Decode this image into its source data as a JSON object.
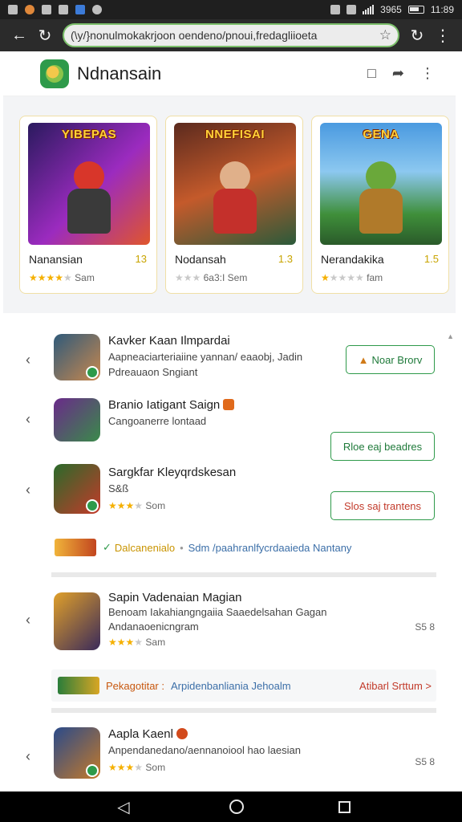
{
  "status_bar": {
    "time": "11:89",
    "network": "3965"
  },
  "browser": {
    "url": "(\\y/}nonulmokakrjoon oendeno/pnoui,fredagliioeta",
    "back_icon": "arrow-left-icon",
    "reload_icon": "reload-icon",
    "bookmark_icon": "star-icon",
    "menu_icon": "more-vert-icon"
  },
  "app": {
    "title": "Ndnansain",
    "logo_icon": "app-logo-icon",
    "actions": [
      "bookmark-icon",
      "share-icon",
      "more-vert-icon"
    ]
  },
  "featured": [
    {
      "banner": "YIBEPAS",
      "name": "Nanansian",
      "score": "13",
      "meta": "Sam",
      "stars_on": 4,
      "stars_total": 5,
      "accent": "#7b2fbf"
    },
    {
      "banner": "NNEFISAI",
      "name": "Nodansah",
      "score": "1.3",
      "meta": "6a3:I Sem",
      "stars_on": 0,
      "stars_total": 3,
      "accent": "#c43b2b"
    },
    {
      "banner": "GENA",
      "name": "Nerandakika",
      "score": "1.5",
      "meta": "fam",
      "stars_on": 1,
      "stars_total": 5,
      "accent": "#3f8f3a"
    }
  ],
  "list": [
    {
      "title": "Kavker Kaan Ilmpardai",
      "sub": "Aapneaciarteriaiine yannan/ eaaobj, Jadin",
      "meta": "Pdreauaon Sngiant",
      "button": "Noar Brorv"
    },
    {
      "title": "Branio Iatigant Saign",
      "sub": "Cangoanerre lontaad",
      "button": "Rloe eaj beadres"
    },
    {
      "title": "Sargkfar Kleyqrdskesan",
      "sub": "S&ß",
      "meta": "Som",
      "button": "Slos saj trantens"
    },
    {
      "title": "Sapin Vadenaian Magian",
      "sub": "Benoam Iakahiangngaiia Saaedelsahan Gagan",
      "sub2": "Andanaoenicngram",
      "meta": "Sam",
      "price": "S5 8"
    },
    {
      "title": "Aapla Kaenl",
      "sub": "Anpendanedano/aennanoiool  hao laesian",
      "meta": "Som",
      "price": "S5 8"
    }
  ],
  "promos": [
    {
      "label": "Dalcanenialo",
      "rest": "Sdm /paahranlfycrdaaieda Nantany"
    },
    {
      "label": "Pekagotitar :",
      "rest": "Arpidenbanliania Jehoalm",
      "link": "Atibarl Srttum >"
    }
  ],
  "colors": {
    "accent_green": "#2e9a4a",
    "star": "#f5b000",
    "toolbar": "#2b2b2b"
  }
}
